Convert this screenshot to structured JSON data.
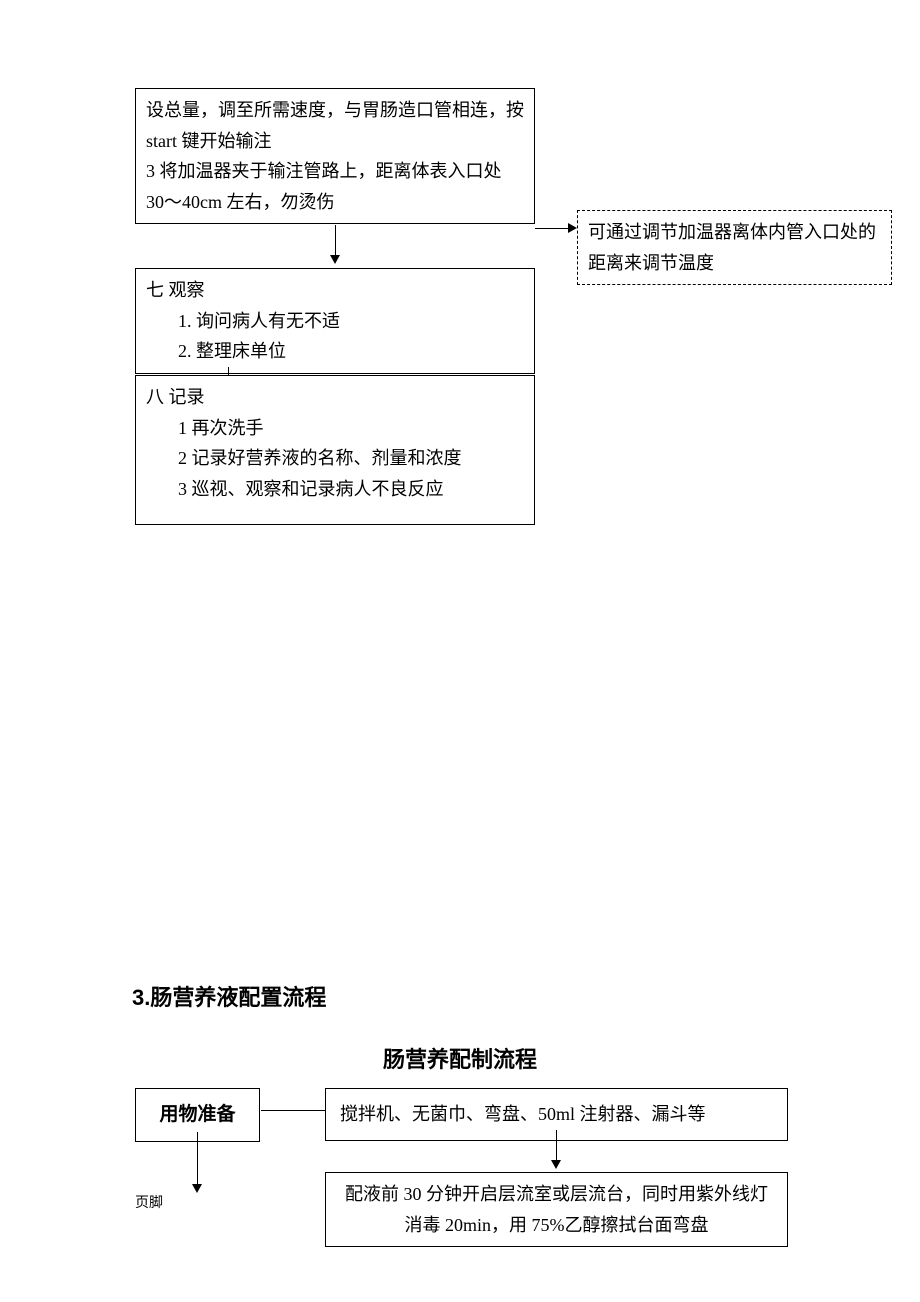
{
  "box_top": {
    "line1": "设总量，调至所需速度，与胃肠造口管相连，按",
    "line2": "start 键开始输注",
    "line3": "3 将加温器夹于输注管路上，距离体表入口处",
    "line4": "30～40cm 左右，勿烫伤"
  },
  "side_note": {
    "line1": "可通过调节加温器离体内管入口处的",
    "line2": "距离来调节温度"
  },
  "box_seven": {
    "title": "七 观察",
    "item1": "1.  询问病人有无不适",
    "item2": "2.  整理床单位"
  },
  "box_eight": {
    "title": "八 记录",
    "item1": "1 再次洗手",
    "item2": "2 记录好营养液的名称、剂量和浓度",
    "item3": "3 巡视、观察和记录病人不良反应"
  },
  "section3_heading": "3.肠营养液配置流程",
  "subheading": "肠营养配制流程",
  "prep_box": "用物准备",
  "prep_right": "搅拌机、无菌巾、弯盘、50ml 注射器、漏斗等",
  "prep_step2": {
    "line1": "配液前 30 分钟开启层流室或层流台，同时用紫外线灯",
    "line2": "消毒 20min，用 75%乙醇擦拭台面弯盘"
  },
  "footer_text": "页脚"
}
